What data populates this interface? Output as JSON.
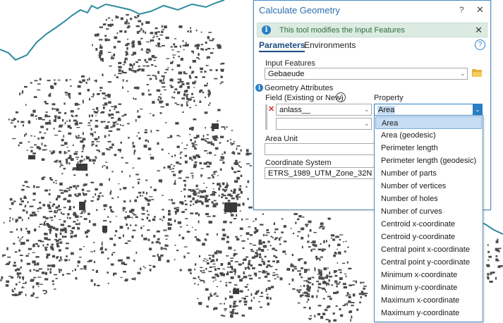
{
  "dialog": {
    "title": "Calculate Geometry",
    "help_glyph": "?",
    "close_glyph": "✕",
    "info_banner": {
      "icon_glyph": "i",
      "text": "This tool modifies the Input Features",
      "close_glyph": "✕"
    },
    "tabs": [
      {
        "label": "Parameters",
        "active": true
      },
      {
        "label": "Environments",
        "active": false
      }
    ],
    "help_icon_glyph": "?",
    "input_features": {
      "label": "Input Features",
      "value": "Gebaeude"
    },
    "geometry_attributes": {
      "label": "Geometry Attributes",
      "icon_glyph": "i",
      "field_header": "Field (Existing or New)",
      "expand_glyph": "⌄",
      "property_header": "Property",
      "rows": [
        {
          "field": "anlass__",
          "property": "Area",
          "remove_glyph": "✕"
        },
        {
          "field": "",
          "property": ""
        }
      ]
    },
    "area_unit": {
      "label": "Area Unit",
      "value": ""
    },
    "coordinate_system": {
      "label": "Coordinate System",
      "value": "ETRS_1989_UTM_Zone_32N"
    },
    "arrow_glyph": "⌄"
  },
  "property_dropdown": {
    "selected": "Area",
    "options": [
      "Area",
      "Area (geodesic)",
      "Perimeter length",
      "Perimeter length (geodesic)",
      "Number of parts",
      "Number of vertices",
      "Number of holes",
      "Number of curves",
      "Centroid x-coordinate",
      "Centroid y-coordinate",
      "Central point x-coordinate",
      "Central point y-coordinate",
      "Minimum x-coordinate",
      "Minimum y-coordinate",
      "Maximum x-coordinate",
      "Maximum y-coordinate"
    ]
  },
  "map": {
    "boundary_color": "#2e8a9e",
    "building_color": "#4a4a4a"
  },
  "colors": {
    "accent": "#2a7fc6",
    "title": "#2a6fb0",
    "banner_bg": "#dcebe2",
    "selection": "#c5dcf2",
    "remove": "#d0342c"
  }
}
